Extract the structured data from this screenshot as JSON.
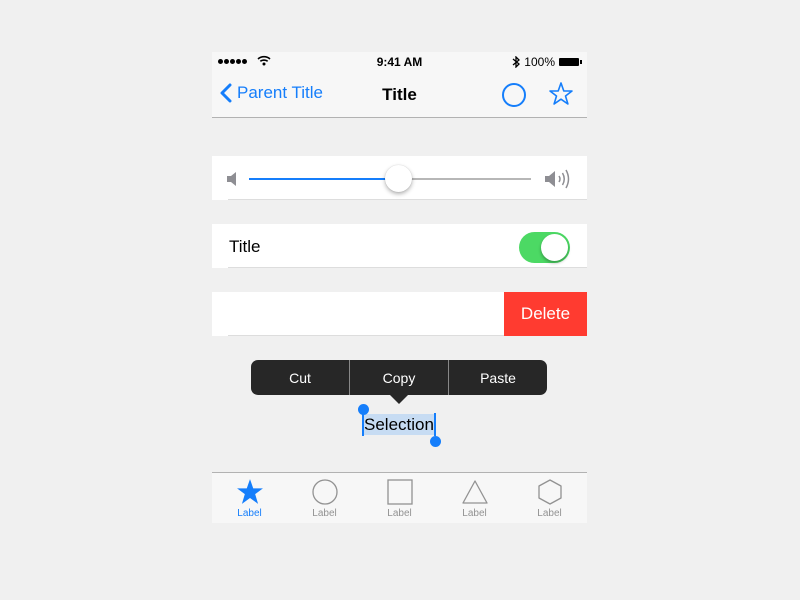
{
  "status_bar": {
    "signal_dots": 5,
    "time": "9:41 AM",
    "battery_percent": "100%"
  },
  "nav_bar": {
    "back_label": "Parent Title",
    "title": "Title",
    "right_icons": [
      "circle-icon",
      "star-icon"
    ]
  },
  "slider": {
    "value_fraction": 0.53,
    "min_icon": "volume-low-icon",
    "max_icon": "volume-high-icon"
  },
  "toggle_row": {
    "title": "Title",
    "on": true
  },
  "delete_row": {
    "delete_label": "Delete"
  },
  "edit_menu": {
    "items": [
      "Cut",
      "Copy",
      "Paste"
    ]
  },
  "selection": {
    "text": "Selection"
  },
  "tab_bar": {
    "tabs": [
      {
        "label": "Label",
        "icon": "star-icon",
        "active": true
      },
      {
        "label": "Label",
        "icon": "circle-icon",
        "active": false
      },
      {
        "label": "Label",
        "icon": "square-icon",
        "active": false
      },
      {
        "label": "Label",
        "icon": "triangle-icon",
        "active": false
      },
      {
        "label": "Label",
        "icon": "hexagon-icon",
        "active": false
      }
    ]
  },
  "colors": {
    "accent": "#157efb",
    "toggle_on": "#4cd964",
    "delete": "#ff3b30",
    "menu_bg": "#272727",
    "selection_bg": "#c7dcf3"
  }
}
